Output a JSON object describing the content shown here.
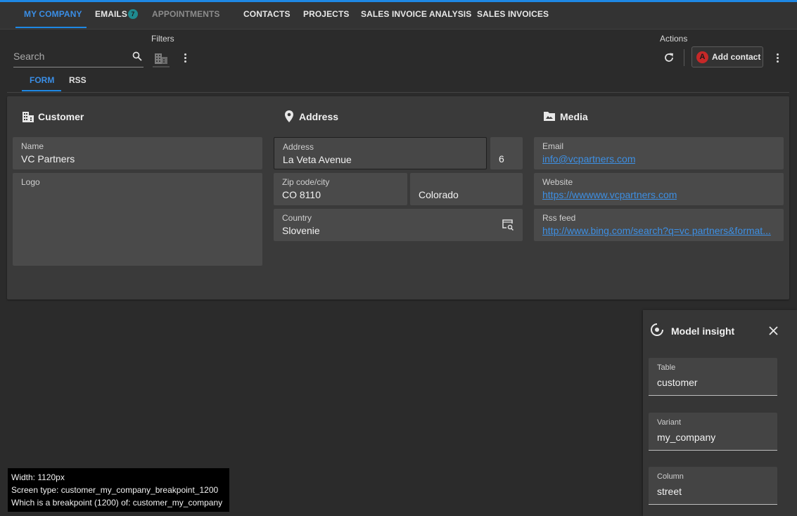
{
  "tabs": [
    {
      "label": "MY COMPANY"
    },
    {
      "label": "EMAILS",
      "badge": "7"
    },
    {
      "label": "APPOINTMENTS"
    },
    {
      "label": "CONTACTS"
    },
    {
      "label": "PROJECTS"
    },
    {
      "label": "SALES INVOICE ANALYSIS"
    },
    {
      "label": "SALES INVOICES"
    }
  ],
  "toolbar": {
    "search_placeholder": "Search",
    "filters_label": "Filters",
    "actions_label": "Actions",
    "add_contact_label": "Add contact",
    "add_contact_avatar": "A"
  },
  "subtabs": [
    {
      "label": "FORM"
    },
    {
      "label": "RSS"
    }
  ],
  "customer": {
    "title": "Customer",
    "name_label": "Name",
    "name_value": "VC Partners",
    "logo_label": "Logo"
  },
  "address": {
    "title": "Address",
    "address_label": "Address",
    "address_value": "La Veta Avenue",
    "number_value": "6",
    "zip_label": "Zip code/city",
    "zip_value": "CO 8110",
    "city_value": "Colorado",
    "country_label": "Country",
    "country_value": "Slovenie"
  },
  "media": {
    "title": "Media",
    "email_label": "Email",
    "email_value": "info@vcpartners.com",
    "website_label": "Website",
    "website_value": "https://wwwww.vcpartners.com",
    "rss_label": "Rss feed",
    "rss_value": "http://www.bing.com/search?q=vc partners&format..."
  },
  "insight": {
    "title": "Model insight",
    "table_label": "Table",
    "table_value": "customer",
    "variant_label": "Variant",
    "variant_value": "my_company",
    "column_label": "Column",
    "column_value": "street"
  },
  "debug": {
    "line1": "Width: 1120px",
    "line2": "Screen type: customer_my_company_breakpoint_1200",
    "line3": "Which is a breakpoint (1200) of: customer_my_company"
  },
  "colors": {
    "accent": "#1e88e5",
    "link": "#3d8fe3",
    "badge": "#1f8a8f",
    "avatar": "#c62828"
  }
}
